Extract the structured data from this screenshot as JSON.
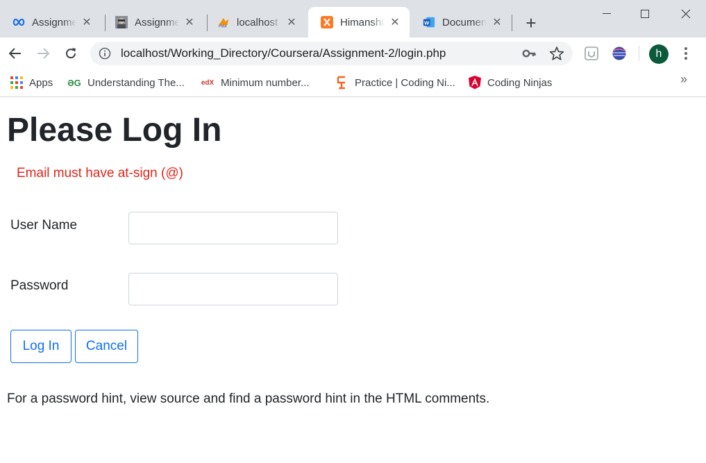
{
  "browser": {
    "tabs": [
      {
        "label": "Assignment",
        "icon": "infinity-icon"
      },
      {
        "label": "Assignment",
        "icon": "avatar-icon"
      },
      {
        "label": "localhost / ",
        "icon": "phpmyadmin-icon"
      },
      {
        "label": "Himanshu",
        "icon": "xampp-icon"
      },
      {
        "label": "Document",
        "icon": "word-icon"
      }
    ],
    "active_tab_index": 3,
    "url": "localhost/Working_Directory/Coursera/Assignment-2/login.php",
    "profile_initial": "h",
    "bookmarks": [
      {
        "label": "Apps",
        "icon": "apps-grid-icon"
      },
      {
        "label": "Understanding The...",
        "icon": "geeksforgeeks-icon",
        "icon_text": "ƏG"
      },
      {
        "label": "Minimum number...",
        "icon": "edx-icon",
        "icon_text": "edX"
      },
      {
        "label": "Practice | Coding Ni...",
        "icon": "coding-ninjas-icon"
      },
      {
        "label": "Coding Ninjas",
        "icon": "angular-icon"
      }
    ],
    "overflow_label": "»"
  },
  "page": {
    "title": "Please Log In",
    "error": "Email must have at-sign (@)",
    "username_label": "User Name",
    "username_value": "",
    "password_label": "Password",
    "password_value": "",
    "login_button": "Log In",
    "cancel_button": "Cancel",
    "hint": "For a password hint, view source and find a password hint in the HTML comments."
  },
  "colors": {
    "error": "#e0261b",
    "button": "#0d6efd",
    "titlebar": "#dee1e6"
  }
}
